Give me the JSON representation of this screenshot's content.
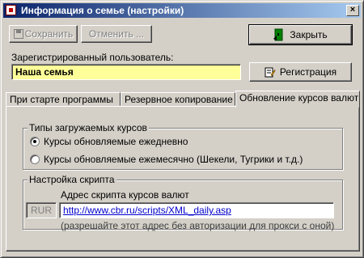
{
  "window": {
    "title": "Информация о семье (настройки)",
    "close_glyph": "×"
  },
  "toolbar": {
    "save_label": "Сохранить",
    "cancel_label": "Отменить ...",
    "close_label": "Закрыть",
    "register_label": "Регистрация"
  },
  "user": {
    "label": "Зарегистрированный пользователь:",
    "value": "Наша семья",
    "field_color": "#ffff99"
  },
  "tabs": [
    {
      "label": "При старте программы",
      "active": false
    },
    {
      "label": "Резервное копирование",
      "active": false
    },
    {
      "label": "Обновление курсов валют",
      "active": true
    }
  ],
  "rates_group": {
    "caption": "Типы загружаемых курсов",
    "options": [
      {
        "label": "Курсы обновляемые ежедневно",
        "checked": true
      },
      {
        "label": "Курсы обновляемые ежемесячно (Шекели, Тугрики и т.д.)",
        "checked": false
      }
    ]
  },
  "script_group": {
    "caption": "Настройка скрипта",
    "currency_code": "RUR",
    "address_label": "Адрес скрипта курсов валют",
    "address_value": "http://www.cbr.ru/scripts/XML_daily.asp",
    "hint": "(разрешайте этот адрес без авторизации для прокси с оной)"
  },
  "icons": {
    "app": "app-icon",
    "close": "close-door-icon",
    "register": "register-icon",
    "save": "save-icon"
  }
}
